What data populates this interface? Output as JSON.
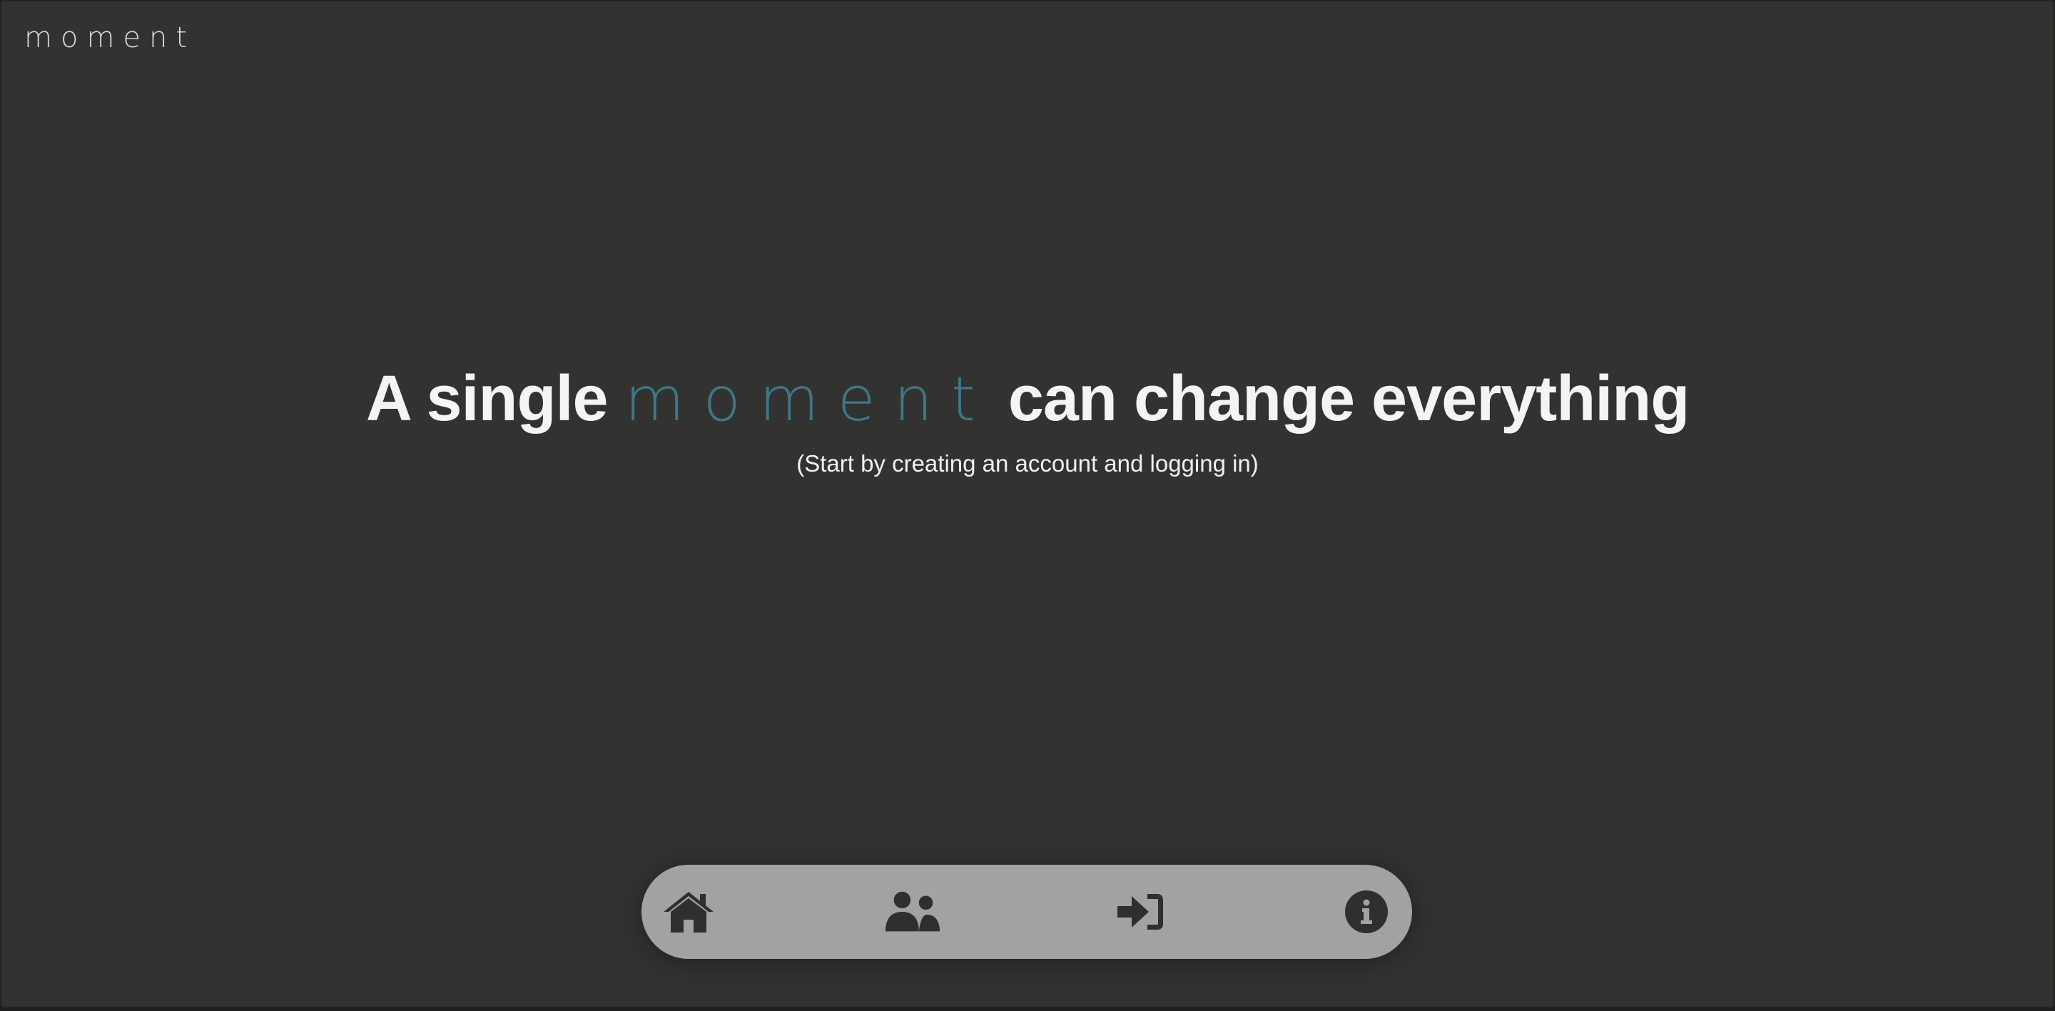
{
  "app": {
    "logo": "moment"
  },
  "hero": {
    "headline_before": "A single ",
    "headline_accent": "moment",
    "headline_after": " can change everything",
    "subline": "(Start by creating an account and logging in)"
  },
  "dock": {
    "items": [
      {
        "icon": "home-icon"
      },
      {
        "icon": "users-icon"
      },
      {
        "icon": "sign-in-icon"
      },
      {
        "icon": "info-icon"
      }
    ]
  },
  "colors": {
    "background": "#323231",
    "accent": "#3e7787",
    "dock": "#a2a2a2",
    "icon": "#2f2f2f",
    "text": "#f4f4f4"
  }
}
